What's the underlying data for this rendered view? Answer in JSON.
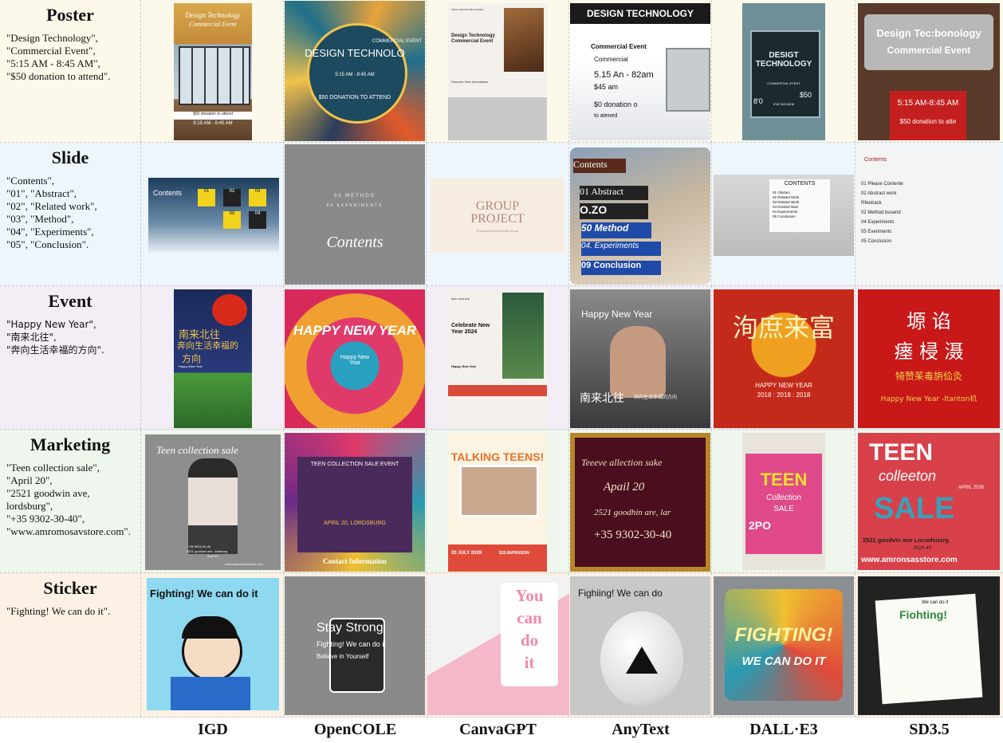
{
  "rows": [
    {
      "category": "Poster",
      "prompt": "\"Design Technology\",\n\"Commercial Event\",\n\"5:15 AM - 8:45 AM\",\n\"$50 donation to attend\".",
      "samples": {
        "igd": {
          "title": "Design Technology",
          "subtitle": "Commercial Event",
          "line1": "$50 donation to attend",
          "line2": "5:15 AM - 8:45 AM"
        },
        "opencole": {
          "top": "COMMERCIAL EVENT",
          "title": "DESIGN TECHNOLO",
          "time": "5:15 AM - 8:45 AM",
          "donation": "$50 DONATION TO ATTEND"
        },
        "canvagpt": {
          "header": "TECH INNOVATORS UNITED",
          "title": "Design Technology Commercial Event",
          "sub": "Discover New Innovations"
        },
        "anytext": {
          "banner": "DESIGN TECHNOLOGY",
          "l1": "Commercial Event",
          "l2": "Commercial",
          "l3": "5.15 An - 82am",
          "l4": "$45 am",
          "l5": "$0 donation o",
          "l6": "to atened"
        },
        "dalle": {
          "title": "DESIGT TECHNOLOGY",
          "sub": "COMMERCIAL EVENT",
          "left": "8'0",
          "right": "$50",
          "bottom": "5'15 34:5 85:M"
        },
        "sd": {
          "l1": "Design Tec:bonology",
          "l2": "Commercial Event",
          "l3": "5:15 AM-8:45 AM",
          "l4": "$50 donation to atte"
        }
      }
    },
    {
      "category": "Slide",
      "prompt": "\"Contents\",\n\"01\", \"Abstract\",\n\"02\", \"Related work\",\n\"03\", \"Method\",\n\"04\", \"Experiments\",\n\"05\", \"Conclusion\".",
      "samples": {
        "igd": {
          "title": "Contents",
          "b1": "01",
          "b2": "02",
          "b3": "03",
          "b4": "05",
          "b5": "04"
        },
        "opencole": {
          "top1": "03 METHOD",
          "top2": "04 EXPERIMENTS",
          "title": "Contents"
        },
        "canvagpt": {
          "title": "GROUP PROJECT",
          "sub": "Presented by Rareville Group"
        },
        "anytext": {
          "s0": "Contents",
          "s1": "01 Abstract",
          "s2": "O.ZO",
          "s3": "50 Method",
          "s4": "04. Experiments",
          "s5": "09 Conclusion"
        },
        "dalle": {
          "title": "CONTENTS",
          "items": [
            "01 Obstact",
            "02 Related Work",
            "03 Related Work",
            "04 Eveded Wod",
            "04 Experiments",
            "05 Conolusion"
          ]
        },
        "sd": {
          "title": "Contents",
          "items": [
            "01 Please Contente",
            "02 Abstract work",
            "Rfeetrack",
            "02 Method busend",
            "04 Experiments",
            "05 Exeriments",
            "05 Conclusion"
          ]
        }
      }
    },
    {
      "category": "Event",
      "prompt": "\"Happy New Year\",\n\"南来北往\",\n\"奔向生活幸福的方向\".",
      "samples": {
        "igd": {
          "l1": "南来北往",
          "l2": "奔向生活幸福的",
          "l3": "方向",
          "l4": "Happy New Year"
        },
        "opencole": {
          "title": "HAPPY NEW YEAR",
          "badge": "Happy New Year"
        },
        "canvagpt": {
          "header": "NEW YEAR EVE",
          "title": "Celebrate New Year 2024",
          "sub": "Happy New Year"
        },
        "anytext": {
          "top": "Happy New Year",
          "bottom": "南来北往",
          "bottom2": "奔向生活幸福的方向"
        },
        "dalle": {
          "big": "洵庶来富",
          "sub": "HAPPY NEW YEAR",
          "years": "2018 : 2018 : 2018"
        },
        "sd": {
          "l1": "塬 谄",
          "l2": "瘗 梫 滠",
          "l3": "犄赞茱毒旃佡灸",
          "l4": "Happy New Year -Itanton机"
        }
      }
    },
    {
      "category": "Marketing",
      "prompt": "\"Teen collection sale\",\n\"April 20\",\n\"2521 goodwin ave, lordsburg\",\n\"+35 9302-30-40\",\n\"www.amromosavstore.com\".",
      "samples": {
        "igd": {
          "title": "Teen collection sale",
          "l1": "+35 9302-30-40",
          "l2": "2521 goodwin ave, lordsburg",
          "l3": "April 20",
          "l4": "www.amromosavstore.com"
        },
        "opencole": {
          "title": "TEEN COLLECTION SALE EVENT",
          "date": "APRIL 20, LORDSBURG",
          "bottom": "Contact Information"
        },
        "canvagpt": {
          "title": "TALKING TEENS!",
          "date": "20 JULY 2028",
          "price": "$15.00/PERSON"
        },
        "anytext": {
          "l1": "Teeeve allection sake",
          "l2": "Apail 20",
          "l3": "2521 goodhin are, lar",
          "l4": "+35 9302-30-40"
        },
        "dalle": {
          "title": "TEEN",
          "sub": "Collection",
          "sale": "SALE",
          "num": "2PO"
        },
        "sd": {
          "l1": "TEEN",
          "l2": "colleeton",
          "l3": "SALE",
          "l4": "APRIL 2030",
          "l5": "2521 goodvin ave Lorsidsusrg",
          "l6": "9920-40",
          "l7": "www.amronsasstore.com"
        }
      }
    },
    {
      "category": "Sticker",
      "prompt": "\"Fighting! We can do it\".",
      "samples": {
        "igd": {
          "title": "Fighting! We can do it"
        },
        "opencole": {
          "l1": "Stay Strong",
          "l2": "Fighting! We can do it",
          "l3": "Believe in Yourself"
        },
        "canvagpt": {
          "l1": "You",
          "l2": "can",
          "l3": "do",
          "l4": "it"
        },
        "anytext": {
          "title": "Fighiing! We can do"
        },
        "dalle": {
          "l1": "FIGHTING!",
          "l2": "WE CAN DO IT"
        },
        "sd": {
          "l1": "We can do it",
          "l2": "Fiohting!"
        }
      }
    }
  ],
  "methods": [
    "IGD",
    "OpenCOLE",
    "CanvaGPT",
    "AnyText",
    "DALL·E3",
    "SD3.5"
  ]
}
